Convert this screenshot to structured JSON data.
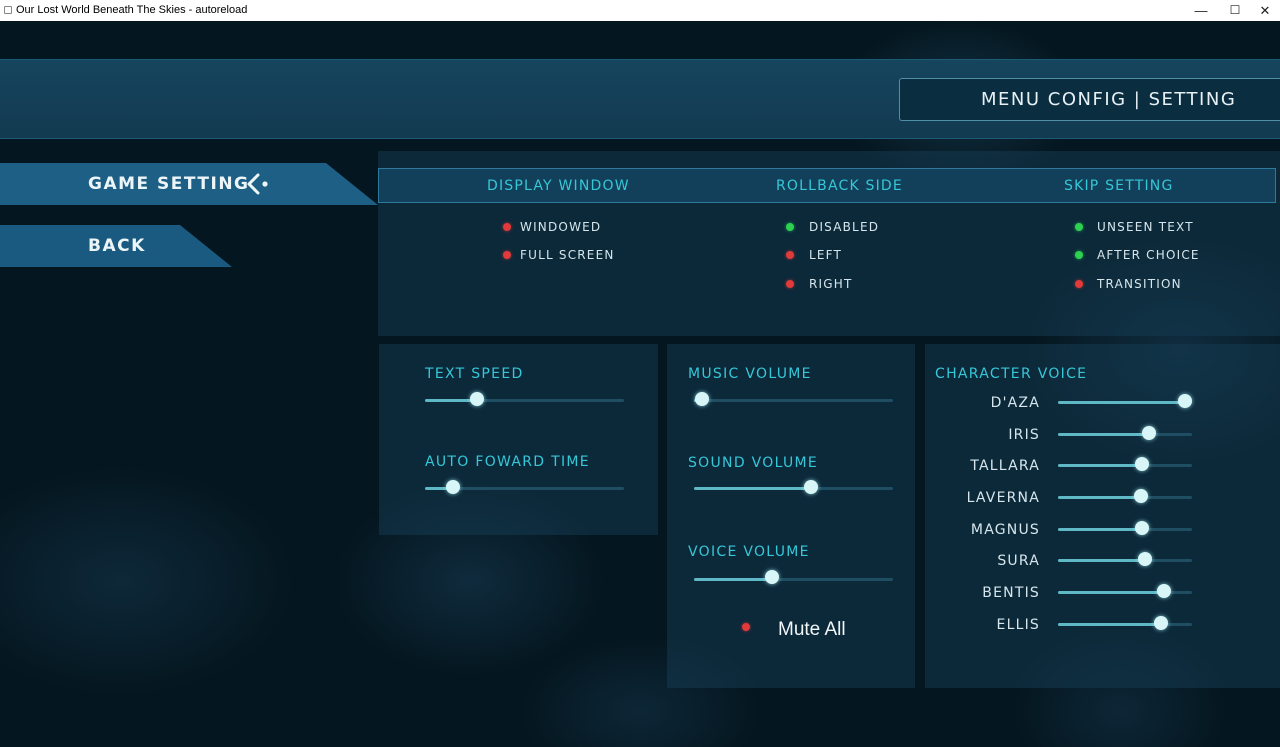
{
  "window": {
    "title": "Our Lost World Beneath The Skies - autoreload",
    "minimize_glyph": "—",
    "maximize_glyph": "☐",
    "close_glyph": "✕"
  },
  "header": {
    "menu_title": "MENU CONFIG | SETTING"
  },
  "nav": {
    "game_setting": "GAME SETTING",
    "game_setting_icon": "chevron-left-dot-icon",
    "back": "BACK"
  },
  "display_window": {
    "title": "DISPLAY WINDOW",
    "options": [
      {
        "label": "WINDOWED",
        "status": "red"
      },
      {
        "label": "FULL SCREEN",
        "status": "red"
      }
    ]
  },
  "rollback_side": {
    "title": "ROLLBACK SIDE",
    "options": [
      {
        "label": "DISABLED",
        "status": "green"
      },
      {
        "label": "LEFT",
        "status": "red"
      },
      {
        "label": "RIGHT",
        "status": "red"
      }
    ]
  },
  "skip_setting": {
    "title": "SKIP SETTING",
    "options": [
      {
        "label": "UNSEEN TEXT",
        "status": "green"
      },
      {
        "label": "AFTER CHOICE",
        "status": "green"
      },
      {
        "label": "TRANSITION",
        "status": "red"
      }
    ]
  },
  "text_panel": {
    "text_speed": {
      "label": "TEXT SPEED",
      "value": 0.26
    },
    "auto_forward": {
      "label": "AUTO FOWARD TIME",
      "value": 0.14
    }
  },
  "volume_panel": {
    "music": {
      "label": "MUSIC VOLUME",
      "value": 0.04
    },
    "sound": {
      "label": "SOUND VOLUME",
      "value": 0.59
    },
    "voice": {
      "label": "VOICE VOLUME",
      "value": 0.39
    },
    "mute_all": {
      "label": "Mute All",
      "status": "red"
    }
  },
  "character_voice": {
    "title": "CHARACTER VOICE",
    "characters": [
      {
        "name": "D'AZA",
        "value": 0.95
      },
      {
        "name": "IRIS",
        "value": 0.68
      },
      {
        "name": "TALLARA",
        "value": 0.63
      },
      {
        "name": "LAVERNA",
        "value": 0.62
      },
      {
        "name": "MAGNUS",
        "value": 0.63
      },
      {
        "name": "SURA",
        "value": 0.65
      },
      {
        "name": "BENTIS",
        "value": 0.79
      },
      {
        "name": "ELLIS",
        "value": 0.77
      }
    ]
  },
  "colors": {
    "accent_cyan": "#36c7d8",
    "status_red": "#e03a3a",
    "status_green": "#2bd14f",
    "nav_blue": "#1e5f86"
  }
}
